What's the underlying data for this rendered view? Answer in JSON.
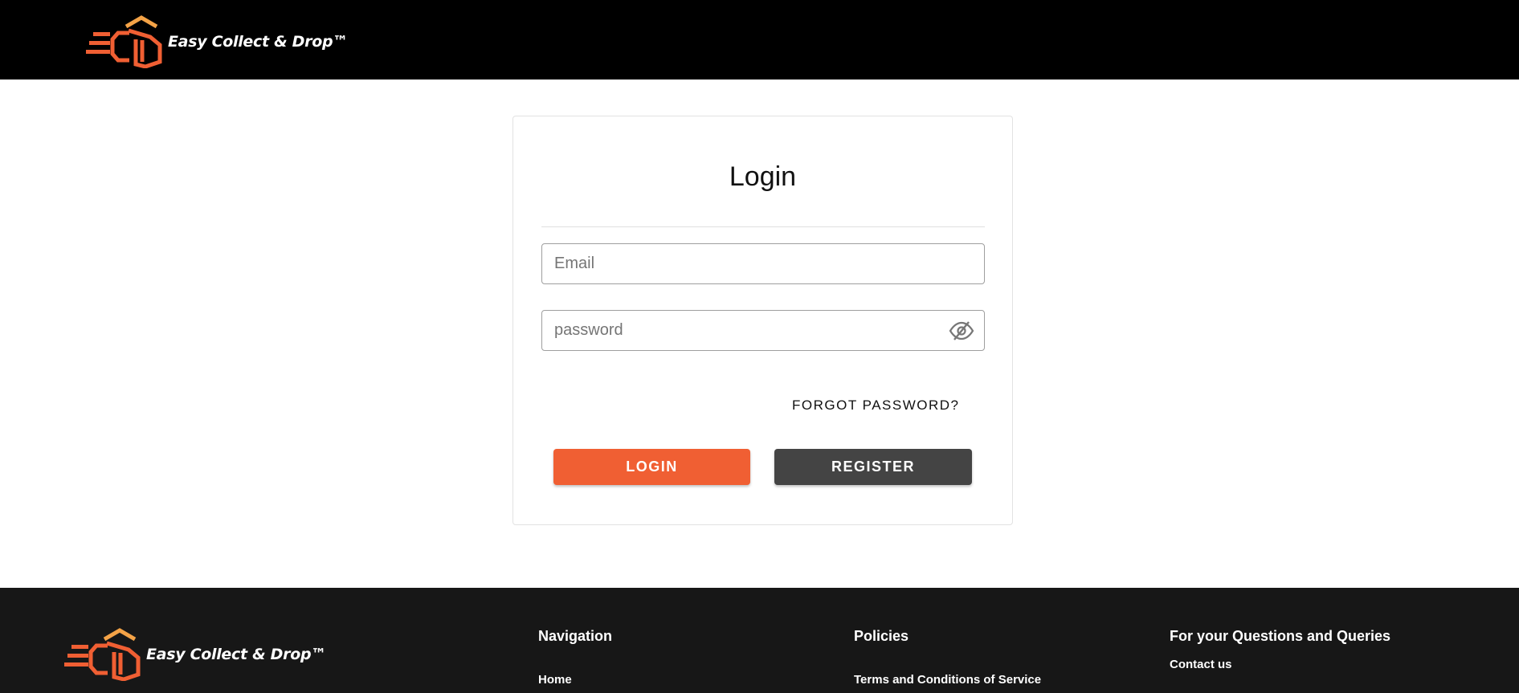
{
  "header": {
    "brand_name": "Easy Collect & Drop™"
  },
  "login_card": {
    "title": "Login",
    "email_placeholder": "Email",
    "password_placeholder": "password",
    "forgot_password_label": "FORGOT PASSWORD?",
    "login_button_label": "LOGIN",
    "register_button_label": "REGISTER"
  },
  "footer": {
    "brand_name": "Easy Collect & Drop™",
    "columns": [
      {
        "title": "Navigation",
        "links": [
          "Home"
        ]
      },
      {
        "title": "Policies",
        "links": [
          "Terms and Conditions of Service"
        ]
      },
      {
        "title": "For your Questions and Queries",
        "links": [
          "Contact us"
        ]
      }
    ]
  },
  "colors": {
    "brand_orange": "#f05f33",
    "logo_top_yellow": "#f4a347",
    "header_bg": "#000000",
    "footer_bg": "#171717",
    "register_button_bg": "#444444"
  },
  "icons": {
    "logo": "ecd-logo-icon",
    "password_toggle": "eye-slash-icon"
  }
}
